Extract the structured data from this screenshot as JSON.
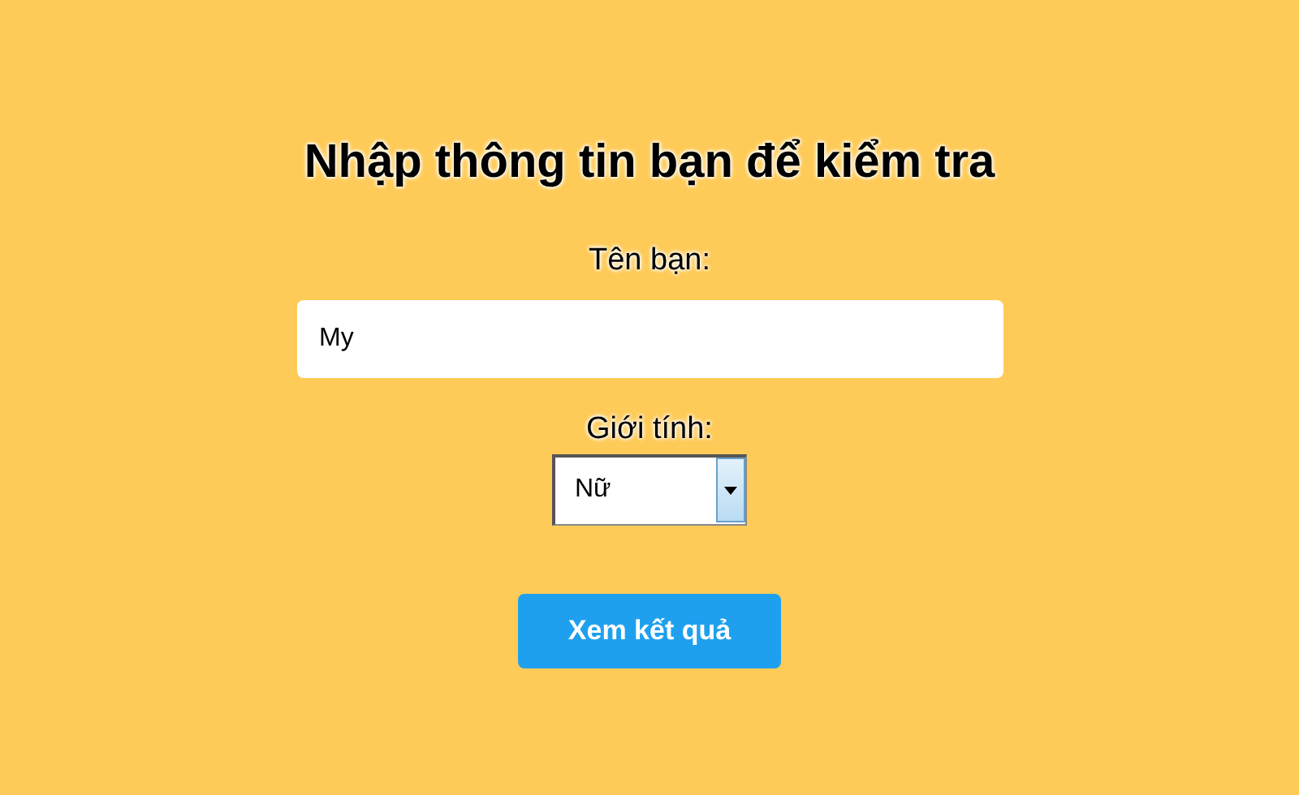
{
  "title": "Nhập thông tin bạn để kiểm tra",
  "name_field": {
    "label": "Tên bạn:",
    "value": "My"
  },
  "gender_field": {
    "label": "Giới tính:",
    "value": "Nữ"
  },
  "submit_button": {
    "label": "Xem kết quả"
  }
}
